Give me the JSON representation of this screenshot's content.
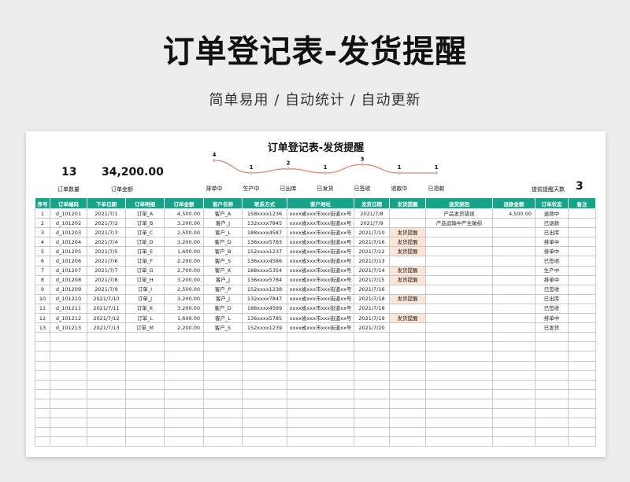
{
  "title": "订单登记表-发货提醒",
  "subtitle": "简单易用 / 自动统计 / 自动更新",
  "sheet": {
    "title": "订单登记表-发货提醒",
    "stats": {
      "order_count": "13",
      "order_count_label": "订单数量",
      "order_amount": "34,200.00",
      "order_amount_label": "订单金额"
    },
    "status_counts": [
      {
        "label": "排单中",
        "value": 4
      },
      {
        "label": "生产中",
        "value": 1
      },
      {
        "label": "已出库",
        "value": 2
      },
      {
        "label": "已发货",
        "value": 1
      },
      {
        "label": "已签收",
        "value": 3
      },
      {
        "label": "退款中",
        "value": 1
      },
      {
        "label": "已退款",
        "value": 1
      }
    ],
    "reminder": {
      "label": "提前提醒天数",
      "value": "3"
    },
    "columns": [
      "序号",
      "订单编码",
      "下单日期",
      "订单明细",
      "订单金额",
      "客户名称",
      "联系方式",
      "客户地址",
      "发货日期",
      "发货提醒",
      "退货原因",
      "退款金额",
      "订单状态",
      "备注"
    ],
    "rows": [
      {
        "no": "1",
        "code": "d_101201",
        "date": "2021/7/1",
        "detail": "订单_A",
        "amount": "4,500.00",
        "customer": "客户_A",
        "phone": "158xxxx1236",
        "address": "xxxx省xxx市xxx街道xx号",
        "ship_date": "2021/7/8",
        "remind": "",
        "reason": "产品发货错误",
        "refund": "4,500.00",
        "status": "退款中",
        "note": ""
      },
      {
        "no": "2",
        "code": "d_101202",
        "date": "2021/7/2",
        "detail": "订单_B",
        "amount": "3,200.00",
        "customer": "客户_J",
        "phone": "132xxxx7845",
        "address": "xxxx省xxx市xxx街道xx号",
        "ship_date": "2021/7/9",
        "remind": "",
        "reason": "产品运输中产生破损",
        "refund": "",
        "status": "已退款",
        "note": ""
      },
      {
        "no": "3",
        "code": "d_101203",
        "date": "2021/7/3",
        "detail": "订单_C",
        "amount": "2,500.00",
        "customer": "客户_L",
        "phone": "188xxxx4587",
        "address": "xxxx省xxx市xxx街道xx号",
        "ship_date": "2021/7/10",
        "remind": "发货提醒",
        "reason": "",
        "refund": "",
        "status": "已出库",
        "note": ""
      },
      {
        "no": "4",
        "code": "d_101204",
        "date": "2021/7/4",
        "detail": "订单_D",
        "amount": "3,200.00",
        "customer": "客户_D",
        "phone": "136xxxx5783",
        "address": "xxxx省xxx市xxx街道xx号",
        "ship_date": "2021/7/16",
        "remind": "发货提醒",
        "reason": "",
        "refund": "",
        "status": "排单中",
        "note": ""
      },
      {
        "no": "5",
        "code": "d_101205",
        "date": "2021/7/5",
        "detail": "订单_E",
        "amount": "1,600.00",
        "customer": "客户_B",
        "phone": "152xxxx1237",
        "address": "xxxx省xxx市xxx街道xx号",
        "ship_date": "2021/7/12",
        "remind": "发货提醒",
        "reason": "",
        "refund": "",
        "status": "排单中",
        "note": ""
      },
      {
        "no": "6",
        "code": "d_101206",
        "date": "2021/7/6",
        "detail": "订单_F",
        "amount": "2,200.00",
        "customer": "客户_S",
        "phone": "136xxxx4586",
        "address": "xxxx省xxx市xxx街道xx号",
        "ship_date": "2021/7/13",
        "remind": "",
        "reason": "",
        "refund": "",
        "status": "已签收",
        "note": ""
      },
      {
        "no": "7",
        "code": "d_101207",
        "date": "2021/7/7",
        "detail": "订单_G",
        "amount": "2,700.00",
        "customer": "客户_K",
        "phone": "188xxxx5354",
        "address": "xxxx省xxx市xxx街道xx号",
        "ship_date": "2021/7/14",
        "remind": "发货提醒",
        "reason": "",
        "refund": "",
        "status": "生产中",
        "note": ""
      },
      {
        "no": "8",
        "code": "d_101208",
        "date": "2021/7/8",
        "detail": "订单_H",
        "amount": "3,200.00",
        "customer": "客户_J",
        "phone": "136xxxx5784",
        "address": "xxxx省xxx市xxx街道xx号",
        "ship_date": "2021/7/15",
        "remind": "发货提醒",
        "reason": "",
        "refund": "",
        "status": "排单中",
        "note": ""
      },
      {
        "no": "9",
        "code": "d_101209",
        "date": "2021/7/9",
        "detail": "订单_I",
        "amount": "2,500.00",
        "customer": "客户_P",
        "phone": "152xxxx1238",
        "address": "xxxx省xxx市xxx街道xx号",
        "ship_date": "2021/7/16",
        "remind": "",
        "reason": "",
        "refund": "",
        "status": "已签收",
        "note": ""
      },
      {
        "no": "10",
        "code": "d_101210",
        "date": "2021/7/10",
        "detail": "订单_J",
        "amount": "3,200.00",
        "customer": "客户_J",
        "phone": "132xxxx7847",
        "address": "xxxx省xxx市xxx街道xx号",
        "ship_date": "2021/7/18",
        "remind": "发货提醒",
        "reason": "",
        "refund": "",
        "status": "已出库",
        "note": ""
      },
      {
        "no": "11",
        "code": "d_101211",
        "date": "2021/7/11",
        "detail": "订单_K",
        "amount": "3,200.00",
        "customer": "客户_D",
        "phone": "188xxxx4589",
        "address": "xxxx省xxx市xxx街道xx号",
        "ship_date": "2021/7/18",
        "remind": "",
        "reason": "",
        "refund": "",
        "status": "已签收",
        "note": ""
      },
      {
        "no": "12",
        "code": "d_101212",
        "date": "2021/7/12",
        "detail": "订单_L",
        "amount": "1,600.00",
        "customer": "客户_L",
        "phone": "136xxxx5785",
        "address": "xxxx省xxx市xxx街道xx号",
        "ship_date": "2021/7/19",
        "remind": "发货提醒",
        "reason": "",
        "refund": "",
        "status": "排单中",
        "note": ""
      },
      {
        "no": "13",
        "code": "d_101213",
        "date": "2021/7/13",
        "detail": "订单_M",
        "amount": "2,200.00",
        "customer": "客户_S",
        "phone": "152xxxx1239",
        "address": "xxxx省xxx市xxx街道xx号",
        "ship_date": "2021/7/20",
        "remind": "",
        "reason": "",
        "refund": "",
        "status": "已发货",
        "note": ""
      }
    ],
    "empty_rows": 12,
    "colors": {
      "header_bg": "#17a589",
      "remind_bg": "#fbe5d6",
      "spark_line": "#e0876b",
      "spark_dot": "#c8c8c8"
    }
  }
}
